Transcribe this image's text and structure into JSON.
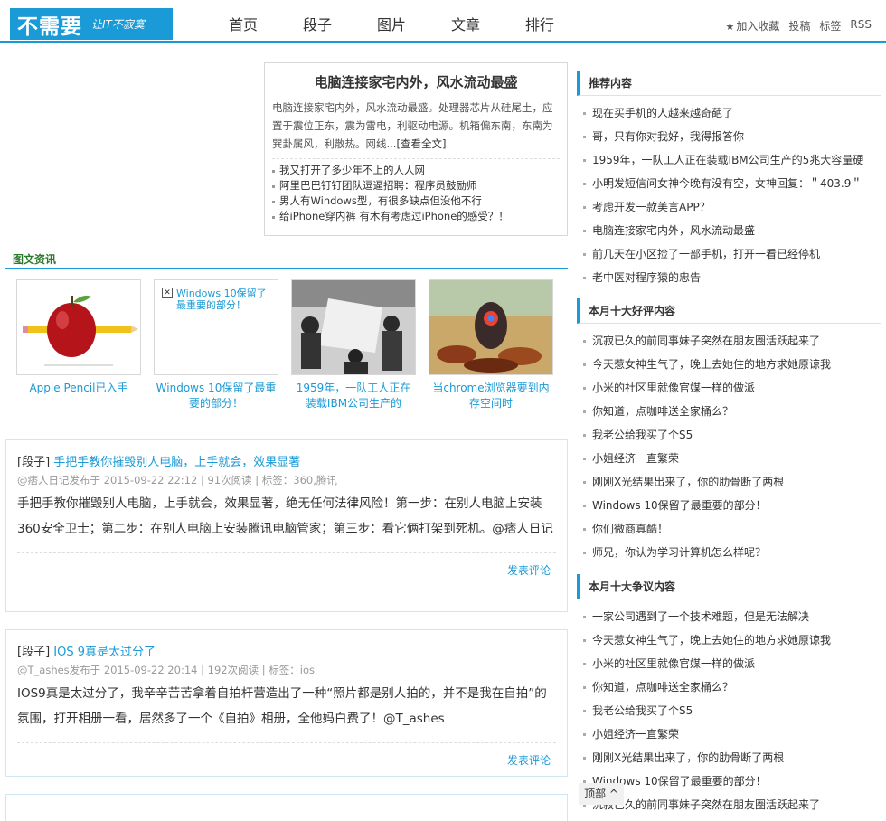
{
  "logo": {
    "main": "不需要",
    "slogan": "让IT不寂寞"
  },
  "nav": [
    "首页",
    "段子",
    "图片",
    "文章",
    "排行"
  ],
  "toplinks": {
    "fav": "加入收藏",
    "submit": "投稿",
    "tags": "标签",
    "rss": "RSS"
  },
  "featured": {
    "title": "电脑连接家宅内外，风水流动最盛",
    "summary": "电脑连接家宅内外，风水流动最盛。处理器芯片从硅尾土，应置于震位正东，震为雷电，利驱动电源。机箱偏东南，东南为巽卦属风，利散热。网线...",
    "more": "[查看全文]",
    "links": [
      "我又打开了多少年不上的人人网",
      "阿里巴巴钉钉团队逗逼招聘：程序员鼓励师",
      "男人有Windows型，有很多缺点但没他不行",
      "给iPhone穿内裤 有木有考虑过iPhone的感受？！"
    ]
  },
  "section_title": "图文资讯",
  "pics": [
    {
      "caption": "Apple Pencil已入手",
      "icon": "apple-pencil-image"
    },
    {
      "caption": "Windows 10保留了最重要的部分！",
      "icon": "broken-image",
      "alt": "Windows 10保留了最重要的部分！"
    },
    {
      "caption": "1959年，一队工人正在装载IBM公司生产的",
      "icon": "ibm-photo"
    },
    {
      "caption": "当chrome浏览器要到内存空间时",
      "icon": "chrome-image"
    }
  ],
  "posts": [
    {
      "category": "[段子]",
      "title": "手把手教你摧毁别人电脑，上手就会，效果显著",
      "meta": "@痞人日记发布于 2015-09-22 22:12 | 91次阅读 | 标签：360,腾讯",
      "body": "手把手教你摧毁别人电脑，上手就会，效果显著，绝无任何法律风险！第一步：在别人电脑上安装360安全卫士；第二步：在别人电脑上安装腾讯电脑管家；第三步：看它俩打架到死机。@痞人日记",
      "comment": "发表评论"
    },
    {
      "category": "[段子]",
      "title": "IOS 9真是太过分了",
      "meta": "@T_ashes发布于 2015-09-22 20:14 | 192次阅读 | 标签：ios",
      "body": "IOS9真是太过分了，我辛辛苦苦拿着自拍杆营造出了一种“照片都是别人拍的，并不是我在自拍”的氛围，打开相册一看，居然多了一个《自拍》相册，全他妈白费了！@T_ashes",
      "comment": "发表评论"
    }
  ],
  "sidebar": [
    {
      "title": "推荐内容",
      "items": [
        "现在买手机的人越来越奇葩了",
        "哥，只有你对我好，我得报答你",
        "1959年，一队工人正在装载IBM公司生产的5兆大容量硬",
        "小明发短信问女神今晚有没有空，女神回复：＂403.9＂",
        "考虑开发一款美言APP？",
        "电脑连接家宅内外，风水流动最盛",
        "前几天在小区捡了一部手机，打开一看已经停机",
        "老中医对程序猿的忠告"
      ]
    },
    {
      "title": "本月十大好评内容",
      "items": [
        "沉寂已久的前同事妹子突然在朋友圈活跃起来了",
        "今天惹女神生气了，晚上去她住的地方求她原谅我",
        "小米的社区里就像官媒一样的做派",
        "你知道，点咖啡送全家桶么？",
        "我老公给我买了个S5",
        "小姐经济一直繁荣",
        "刚刚X光结果出来了，你的肋骨断了两根",
        "Windows 10保留了最重要的部分！",
        "你们微商真酷！",
        "师兄，你认为学习计算机怎么样呢？"
      ]
    },
    {
      "title": "本月十大争议内容",
      "items": [
        "一家公司遇到了一个技术难题，但是无法解决",
        "今天惹女神生气了，晚上去她住的地方求她原谅我",
        "小米的社区里就像官媒一样的做派",
        "你知道，点咖啡送全家桶么？",
        "我老公给我买了个S5",
        "小姐经济一直繁荣",
        "刚刚X光结果出来了，你的肋骨断了两根",
        "Windows 10保留了最重要的部分！",
        "沉寂已久的前同事妹子突然在朋友圈活跃起来了"
      ]
    }
  ],
  "totop": "顶部 ^"
}
